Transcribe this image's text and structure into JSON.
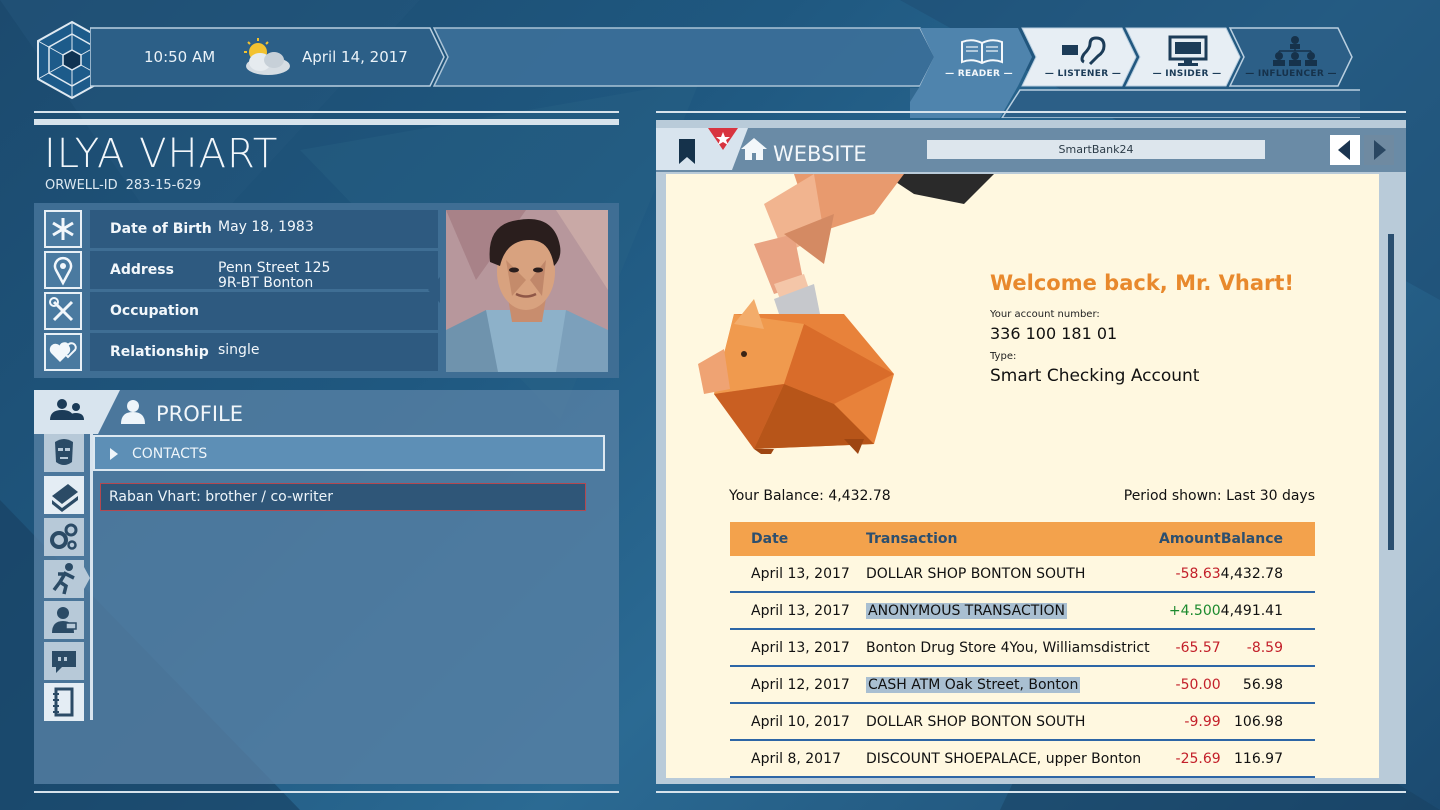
{
  "header": {
    "time": "10:50 AM",
    "date": "April 14, 2017",
    "weather_icon": "partly-cloudy-icon",
    "modes": [
      {
        "label": "— READER —",
        "icon": "book-icon",
        "active": true
      },
      {
        "label": "— LISTENER —",
        "icon": "ear-icon",
        "active": false
      },
      {
        "label": "— INSIDER —",
        "icon": "monitor-icon",
        "active": false
      },
      {
        "label": "— INFLUENCER —",
        "icon": "hierarchy-icon",
        "active": false
      }
    ]
  },
  "person": {
    "name": "ILYA VHART",
    "id_label": "ORWELL-ID",
    "id_value": "283-15-629",
    "fields": [
      {
        "key": "Date of Birth",
        "value": "May 18, 1983",
        "icon": "asterisk-icon"
      },
      {
        "key": "Address",
        "value": "Penn Street 125",
        "value2": "9R-BT Bonton",
        "icon": "location-pin-icon"
      },
      {
        "key": "Occupation",
        "value": "",
        "icon": "tools-icon"
      },
      {
        "key": "Relationship",
        "value": "single",
        "icon": "hearts-icon"
      }
    ]
  },
  "profile": {
    "title": "PROFILE",
    "section": "CONTACTS",
    "contact": "Raban Vhart: brother / co-writer",
    "side_icons": [
      "face-icon",
      "books-icon",
      "gears-icon",
      "running-icon",
      "person-icon",
      "speech-icon",
      "notebook-icon"
    ]
  },
  "website": {
    "title": "WEBSITE",
    "url": "SmartBank24",
    "welcome": "Welcome back, Mr. Vhart!",
    "account_label": "Your account number:",
    "account_number": "336 100 181 01",
    "type_label": "Type:",
    "type_value": "Smart Checking Account",
    "balance": "Your Balance: 4,432.78",
    "period": "Period shown: Last 30 days",
    "columns": [
      "Date",
      "Transaction",
      "Amount",
      "Balance"
    ],
    "rows": [
      {
        "date": "April 13, 2017",
        "tx": "DOLLAR SHOP BONTON SOUTH",
        "amount": "-58.63",
        "balance": "4,432.78",
        "highlight": false
      },
      {
        "date": "April 13, 2017",
        "tx": "ANONYMOUS TRANSACTION",
        "amount": "+4.500",
        "balance": "4,491.41",
        "highlight": true
      },
      {
        "date": "April 13, 2017",
        "tx": "Bonton Drug Store 4You, Williamsdistrict",
        "amount": "-65.57",
        "balance": "-8.59",
        "highlight": false
      },
      {
        "date": "April 12, 2017",
        "tx": "CASH ATM Oak Street, Bonton",
        "amount": "-50.00",
        "balance": "56.98",
        "highlight": true
      },
      {
        "date": "April 10, 2017",
        "tx": "DOLLAR SHOP BONTON SOUTH",
        "amount": "-9.99",
        "balance": "106.98",
        "highlight": false
      },
      {
        "date": "April 8, 2017",
        "tx": "DISCOUNT SHOEPALACE, upper Bonton",
        "amount": "-25.69",
        "balance": "116.97",
        "highlight": false
      }
    ]
  },
  "colors": {
    "accent": "#e8892d",
    "table_header": "#f3a24c",
    "negative": "#c3202a",
    "positive": "#1c8a2e"
  }
}
